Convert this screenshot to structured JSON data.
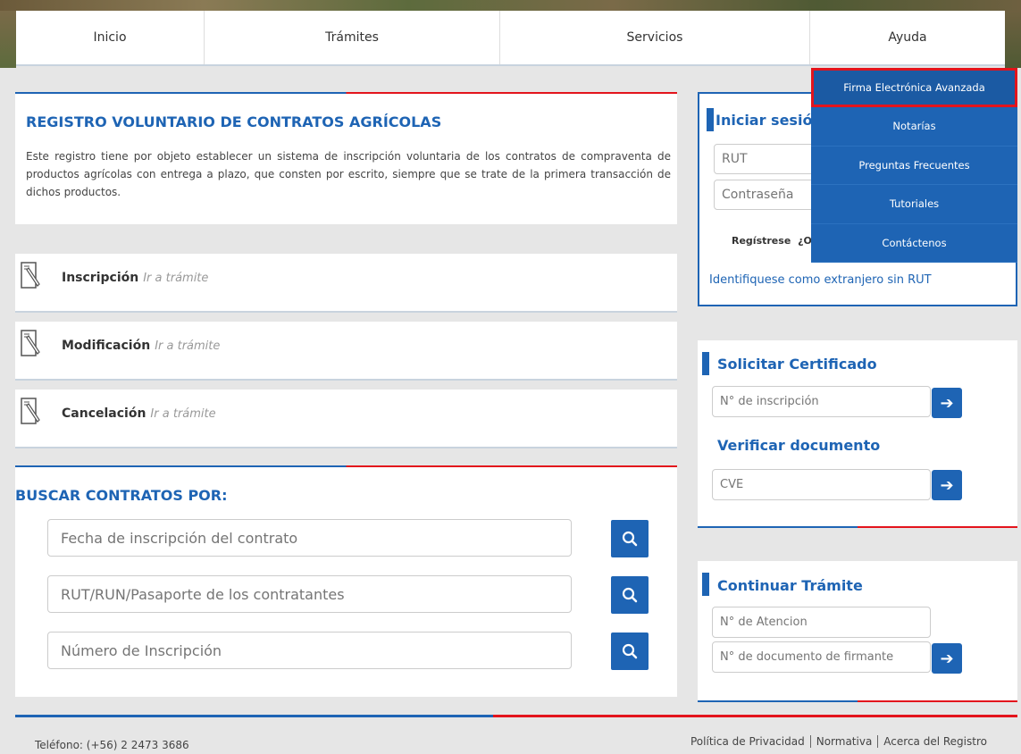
{
  "nav": {
    "items": [
      "Inicio",
      "Trámites",
      "Servicios",
      "Ayuda"
    ]
  },
  "dropdown": {
    "items": [
      "Firma Electrónica Avanzada",
      "Notarías",
      "Preguntas Frecuentes",
      "Tutoriales",
      "Contáctenos"
    ]
  },
  "intro": {
    "title": "REGISTRO VOLUNTARIO DE CONTRATOS AGRÍCOLAS",
    "description": "Este registro tiene por objeto establecer un sistema de inscripción voluntaria de los contratos de compraventa de productos agrícolas con entrega a plazo, que consten por escrito, siempre que se trate de la primera transacción de dichos productos."
  },
  "tramites": [
    {
      "label": "Inscripción",
      "link": "Ir a trámite"
    },
    {
      "label": "Modificación",
      "link": "Ir a trámite"
    },
    {
      "label": "Cancelación",
      "link": "Ir a trámite"
    }
  ],
  "search": {
    "title": "BUSCAR CONTRATOS POR:",
    "fields": [
      {
        "placeholder": "Fecha de inscripción del contrato"
      },
      {
        "placeholder": "RUT/RUN/Pasaporte de los contratantes"
      },
      {
        "placeholder": "Número de Inscripción"
      }
    ]
  },
  "login": {
    "title": "Iniciar sesión",
    "rut_placeholder": "RUT",
    "password_placeholder": "Contraseña",
    "register_label": "Regístrese",
    "forgot_prefix": "¿O",
    "foreign_link": "Identifiquese como extranjero sin RUT"
  },
  "certificado": {
    "title": "Solicitar Certificado",
    "placeholder": "N° de inscripción"
  },
  "verificar": {
    "title": "Verificar documento",
    "placeholder": "CVE"
  },
  "continuar": {
    "title": "Continuar Trámite",
    "atencion_placeholder": "N° de Atencion",
    "documento_placeholder": "N° de documento de firmante"
  },
  "footer": {
    "phone": "Teléfono: (+56) 2 2473 3686",
    "links": [
      "Política de Privacidad",
      "Normativa",
      "Acerca del Registro"
    ]
  },
  "colors": {
    "primary": "#1e64b4",
    "accent_red": "#e3141c"
  },
  "icons": {
    "tramite": "document-pen-icon",
    "search": "search-icon",
    "arrow": "arrow-right-icon"
  }
}
